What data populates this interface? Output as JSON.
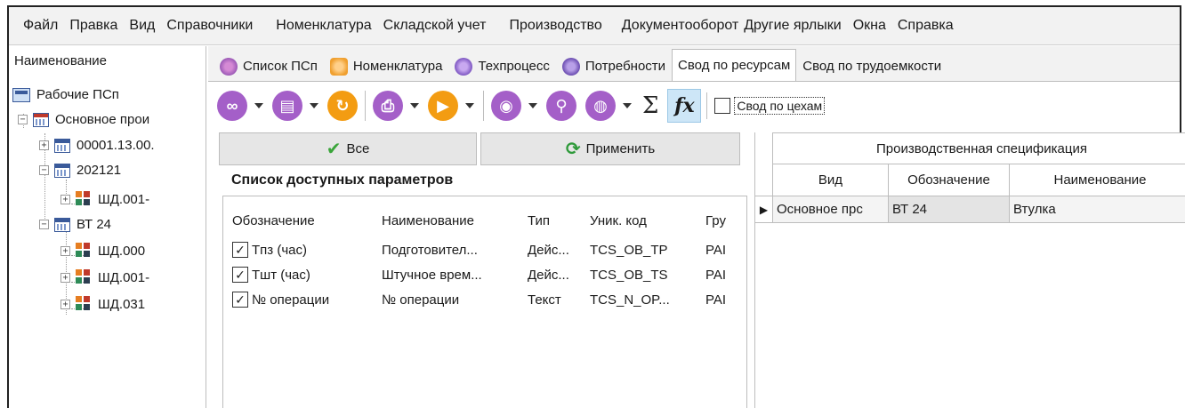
{
  "menu": [
    "Файл",
    "Правка",
    "Вид",
    "Справочники",
    "Номенклатура",
    "Складской учет",
    "Производство",
    "Документооборот",
    "Другие ярлыки",
    "Окна",
    "Справка"
  ],
  "tree": {
    "header": "Наименование",
    "items": [
      {
        "label": "Рабочие ПСп"
      },
      {
        "label": "Основное прои"
      },
      {
        "label": "00001.13.00."
      },
      {
        "label": "202121"
      },
      {
        "label": "ШД.001-"
      },
      {
        "label": "ВТ 24"
      },
      {
        "label": "ШД.000"
      },
      {
        "label": "ШД.001-"
      },
      {
        "label": "ШД.031"
      }
    ]
  },
  "tabs": [
    "Список ПСп",
    "Номенклатура",
    "Техпроцесс",
    "Потребности",
    "Свод по ресурсам",
    "Свод по трудоемкости"
  ],
  "toolbar": {
    "sigma": "Σ",
    "fx": "fx",
    "workshop_checkbox_label": "Свод по цехам"
  },
  "buttons": {
    "all_label": "Все",
    "apply_label": "Применить"
  },
  "params": {
    "title": "Список доступных параметров",
    "columns": [
      "Обозначение",
      "Наименование",
      "Тип",
      "Уник. код",
      "Гру"
    ],
    "rows": [
      {
        "checked": true,
        "designation": "Tпз (час)",
        "name": "Подготовител...",
        "type": "Дейс...",
        "code": "TCS_OB_TP",
        "group": "PAI"
      },
      {
        "checked": true,
        "designation": "Tшт (час)",
        "name": "Штучное врем...",
        "type": "Дейс...",
        "code": "TCS_OB_TS",
        "group": "PAI"
      },
      {
        "checked": true,
        "designation": "№ операции",
        "name": "№ операции",
        "type": "Текст",
        "code": "TCS_N_OP...",
        "group": "PAI"
      }
    ]
  },
  "spec": {
    "group_header": "Производственная спецификация",
    "columns": [
      "Вид",
      "Обозначение",
      "Наименование"
    ],
    "rows": [
      {
        "kind": "Основное прс",
        "designation": "ВТ 24",
        "name": "Втулка"
      }
    ]
  }
}
